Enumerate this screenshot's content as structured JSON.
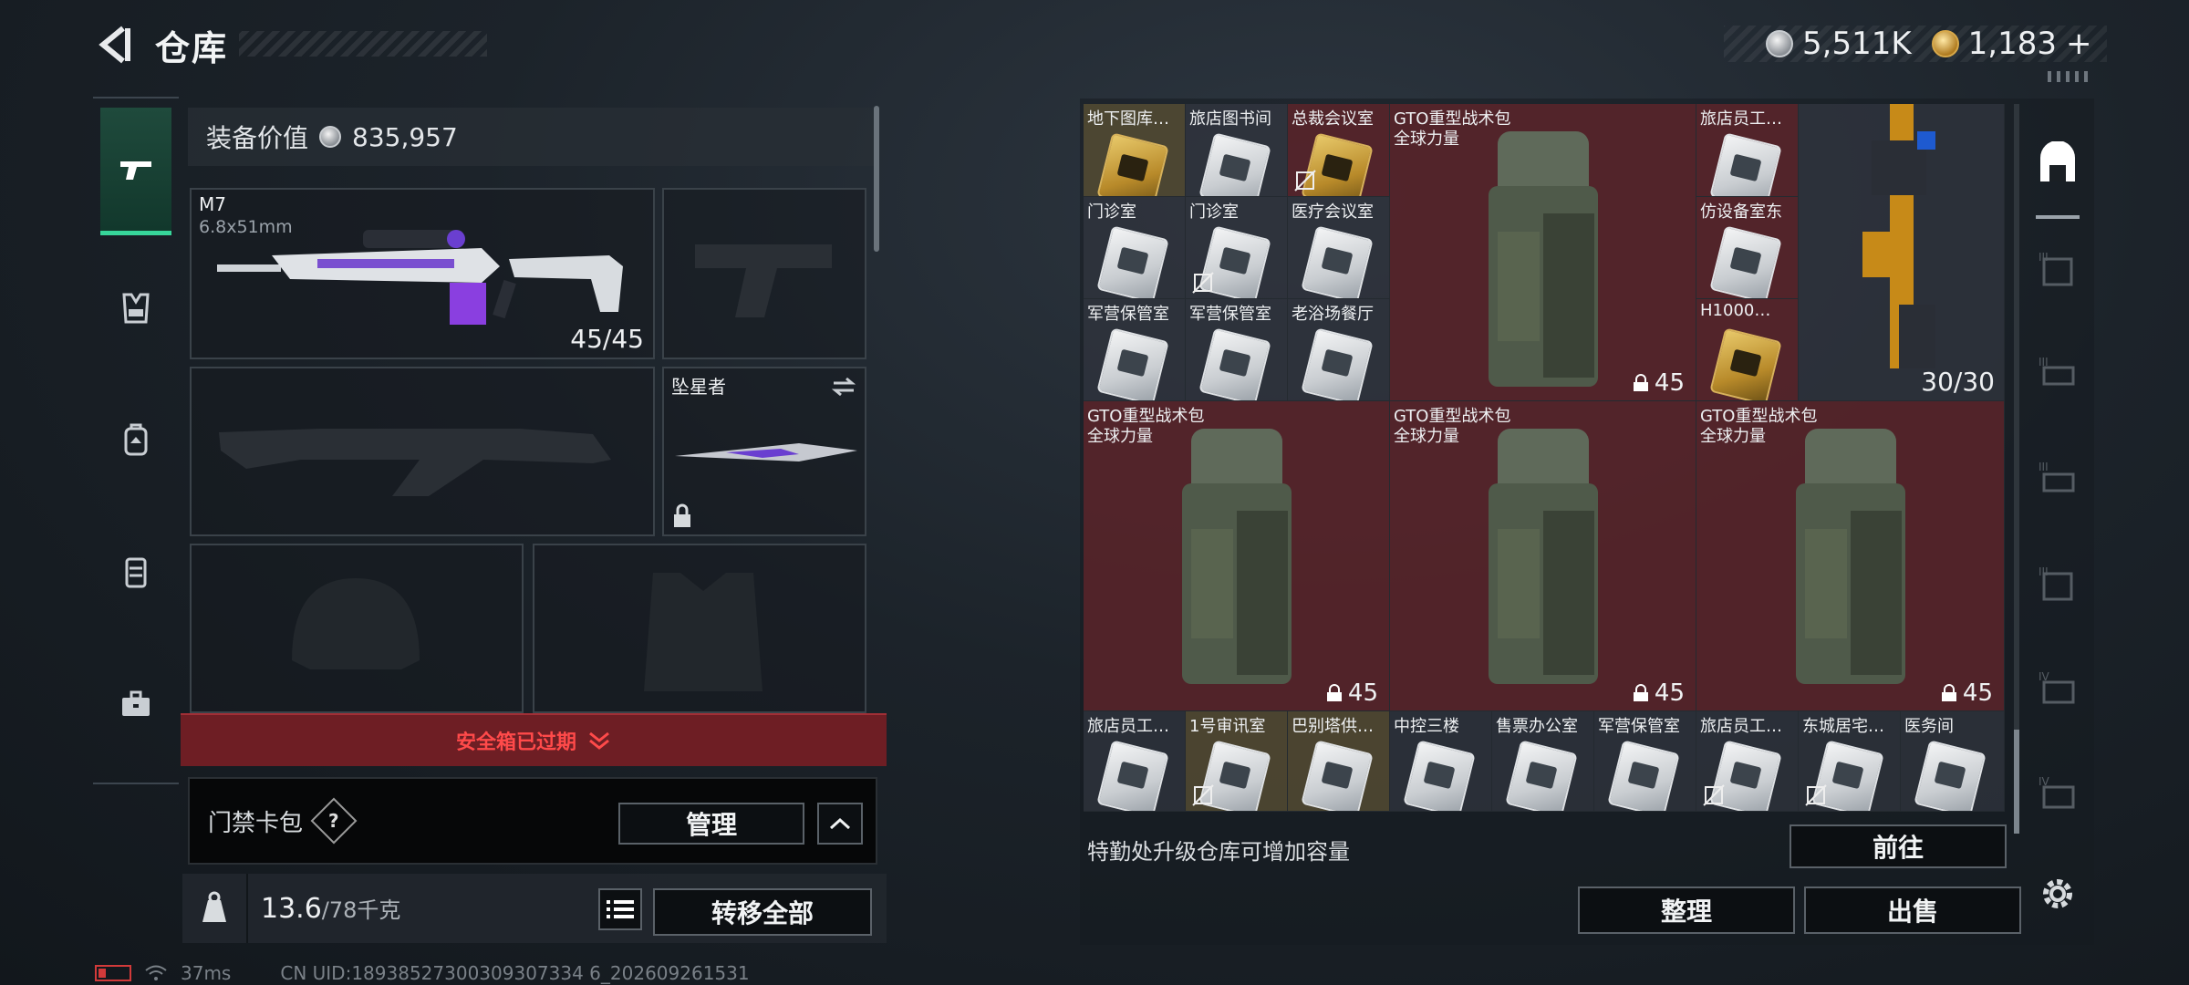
{
  "header": {
    "title": "仓库",
    "currency": [
      {
        "icon": "silver-coin-icon",
        "value": "5,511K"
      },
      {
        "icon": "gold-coin-icon",
        "value": "1,183"
      }
    ],
    "add_label": "+"
  },
  "left": {
    "equip_value_label": "装备价值",
    "equip_value": "835,957",
    "primary_weapon": {
      "name": "M7",
      "caliber": "6.8x51mm",
      "ammo": "45/45"
    },
    "melee": {
      "name": "坠星者"
    },
    "safe_box_text": "安全箱已过期",
    "card_pack_label": "门禁卡包",
    "help_label": "?",
    "manage_label": "管理",
    "weight_current": "13.6",
    "weight_max": "/78千克",
    "transfer_all_label": "转移全部"
  },
  "grid": {
    "row0": [
      "地下图库…",
      "旅店图书间",
      "总裁会议室",
      "旅店员工…"
    ],
    "row1": [
      "门诊室",
      "门诊室",
      "医疗会议室",
      "仿设备室东"
    ],
    "row2": [
      "军营保管室",
      "军营保管室",
      "老浴场餐厅",
      "H1000…"
    ],
    "backpacks": [
      {
        "name": "GTO重型战术包",
        "sub": "全球力量",
        "count": "45"
      },
      {
        "name": "GTO重型战术包",
        "sub": "全球力量",
        "count": "45"
      },
      {
        "name": "GTO重型战术包",
        "sub": "全球力量",
        "count": "45"
      },
      {
        "name": "GTO重型战术包",
        "sub": "全球力量",
        "count": "45"
      }
    ],
    "rifle_ammo": "30/30",
    "bottom_row": [
      "旅店员工…",
      "1号审讯室",
      "巴别塔供…",
      "中控三楼",
      "售票办公室",
      "军营保管室",
      "旅店员工…",
      "东城居宅…",
      "医务间"
    ]
  },
  "footer_right": {
    "upgrade_tip": "特勤处升级仓库可增加容量",
    "goto_label": "前往",
    "sort_label": "整理",
    "sell_label": "出售"
  },
  "right_rail_tiers": [
    "",
    "III",
    "III",
    "III",
    "III",
    "IV",
    "IV"
  ],
  "status": {
    "ping": "37ms",
    "uid": "CN UID:18938527300309307334 6_202609261531"
  },
  "colors": {
    "accent_green": "#37d69a",
    "alert_red": "#ff4a4a",
    "slot_red": "#5c242a"
  }
}
